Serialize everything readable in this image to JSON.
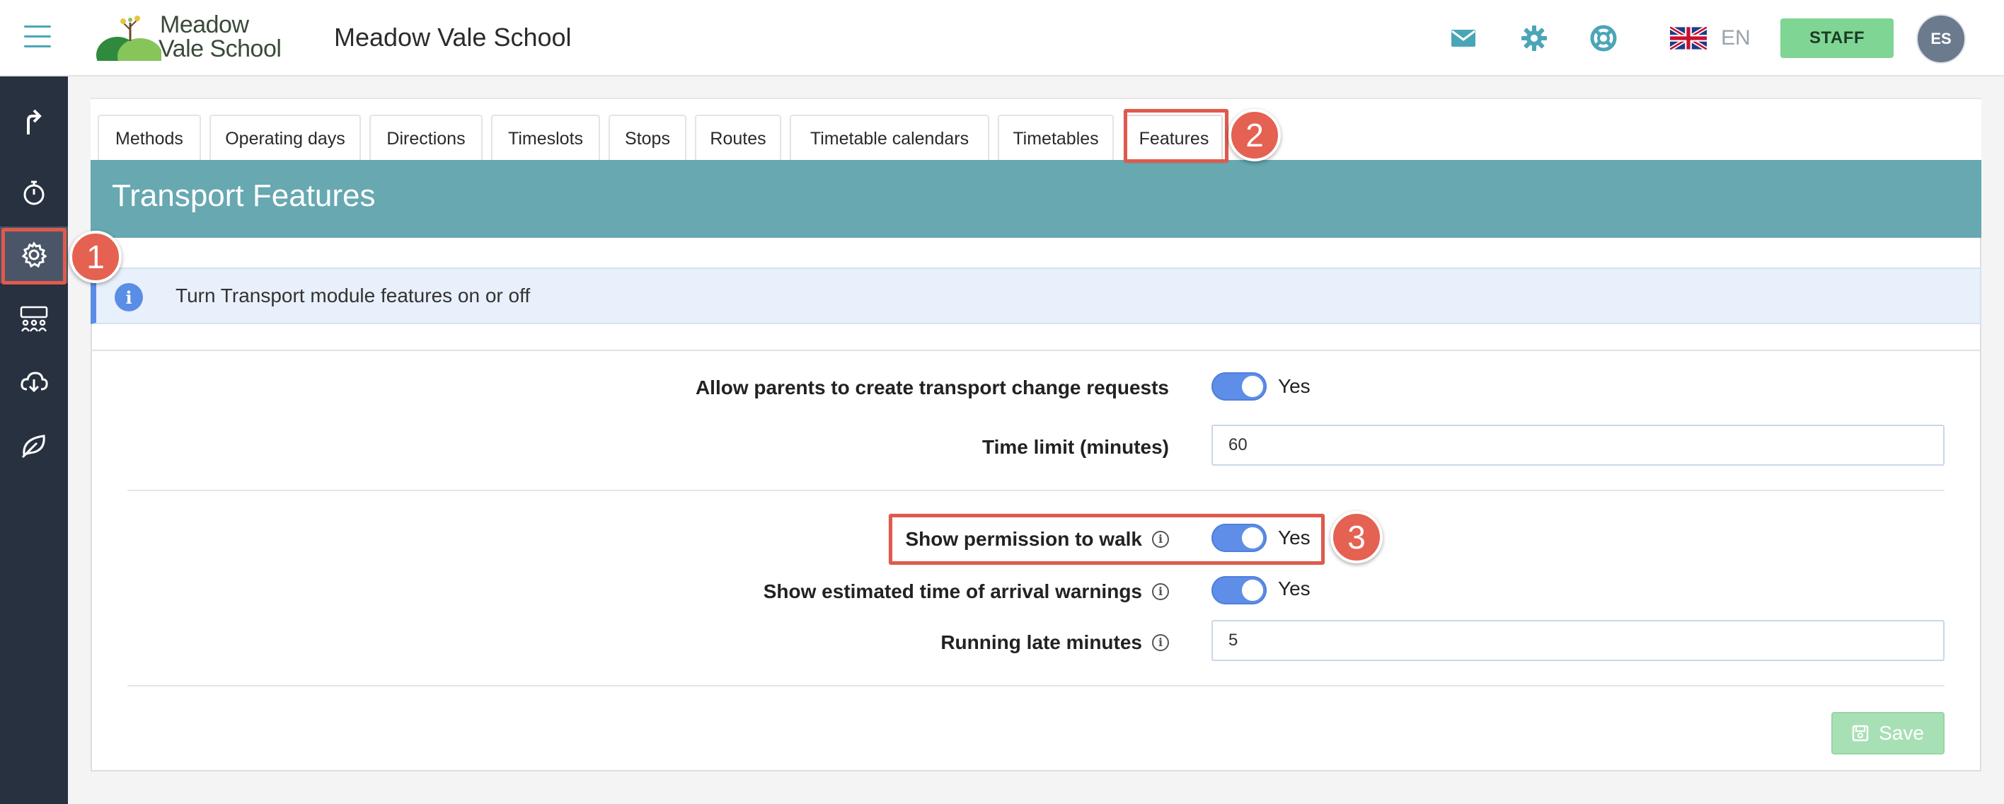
{
  "header": {
    "logo_line1": "Meadow",
    "logo_line2": "Vale School",
    "school_name": "Meadow Vale School",
    "language_code": "EN",
    "staff_label": "STAFF",
    "avatar_initials": "ES",
    "icons": [
      "menu-icon",
      "mail-icon",
      "gear-icon",
      "lifebuoy-icon",
      "uk-flag-icon"
    ],
    "accent_color": "#4aa6b6",
    "staff_color": "#7fd593"
  },
  "sidebar": {
    "items": [
      {
        "icon": "share-arrow-icon"
      },
      {
        "icon": "stopwatch-icon"
      },
      {
        "icon": "gear-icon",
        "active": true
      },
      {
        "icon": "group-icon"
      },
      {
        "icon": "cloud-download-icon"
      },
      {
        "icon": "leaf-icon"
      }
    ],
    "background": "#28313f"
  },
  "tabs": [
    {
      "label": "Methods"
    },
    {
      "label": "Operating days"
    },
    {
      "label": "Directions"
    },
    {
      "label": "Timeslots"
    },
    {
      "label": "Stops"
    },
    {
      "label": "Routes"
    },
    {
      "label": "Timetable calendars"
    },
    {
      "label": "Timetables"
    },
    {
      "label": "Features",
      "active": true
    }
  ],
  "section": {
    "title": "Transport Features",
    "color": "#67a8b1"
  },
  "info": {
    "text": "Turn Transport module features on or off"
  },
  "form": {
    "allow_change_requests": {
      "label": "Allow parents to create transport change requests",
      "value": "Yes",
      "on": true
    },
    "time_limit": {
      "label": "Time limit (minutes)",
      "value": "60"
    },
    "permission_to_walk": {
      "label": "Show permission to walk",
      "value": "Yes",
      "on": true
    },
    "eta_warnings": {
      "label": "Show estimated time of arrival warnings",
      "value": "Yes",
      "on": true
    },
    "running_late": {
      "label": "Running late minutes",
      "value": "5"
    },
    "save_label": "Save"
  },
  "annotations": {
    "markers": [
      "1",
      "2",
      "3"
    ],
    "color": "#e56152"
  }
}
